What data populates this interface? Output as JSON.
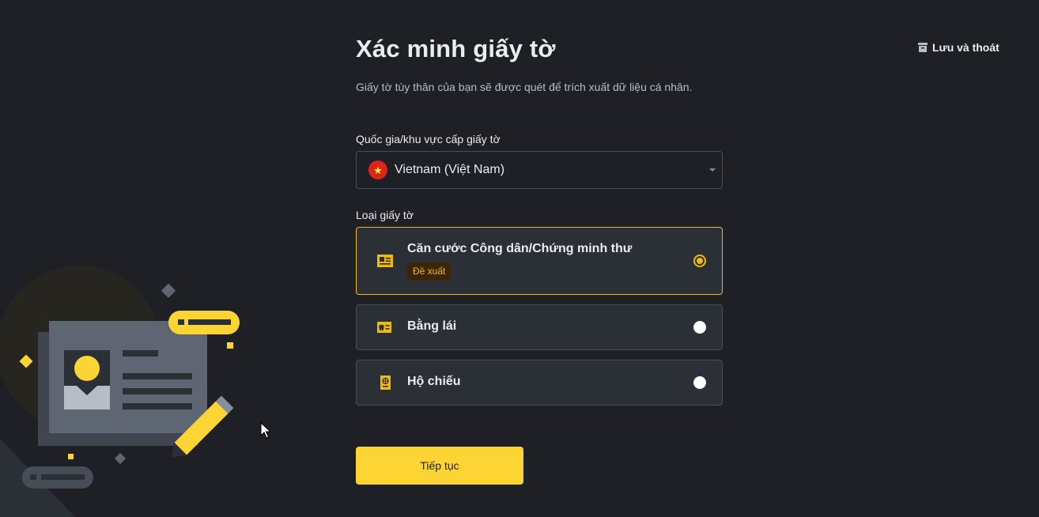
{
  "header": {
    "title": "Xác minh giấy tờ",
    "subtitle": "Giấy tờ tùy thân của bạn sẽ được quét để trích xuất dữ liệu cá nhân.",
    "save_exit_label": "Lưu và thoát"
  },
  "country": {
    "label": "Quốc gia/khu vực cấp giấy tờ",
    "value": "Vietnam (Việt Nam)",
    "flag_icon": "vietnam-flag-icon"
  },
  "document_type": {
    "label": "Loại giấy tờ",
    "options": [
      {
        "label": "Căn cước Công dân/Chứng minh thư",
        "badge": "Đề xuất",
        "selected": true,
        "icon": "id-card-icon"
      },
      {
        "label": "Bằng lái",
        "selected": false,
        "icon": "driver-license-icon"
      },
      {
        "label": "Hộ chiếu",
        "selected": false,
        "icon": "passport-icon"
      }
    ]
  },
  "continue_label": "Tiếp tục",
  "colors": {
    "background": "#1e2026",
    "card": "#2b2f36",
    "border": "#474d57",
    "accent": "#f0b90b",
    "button": "#fcd535"
  }
}
